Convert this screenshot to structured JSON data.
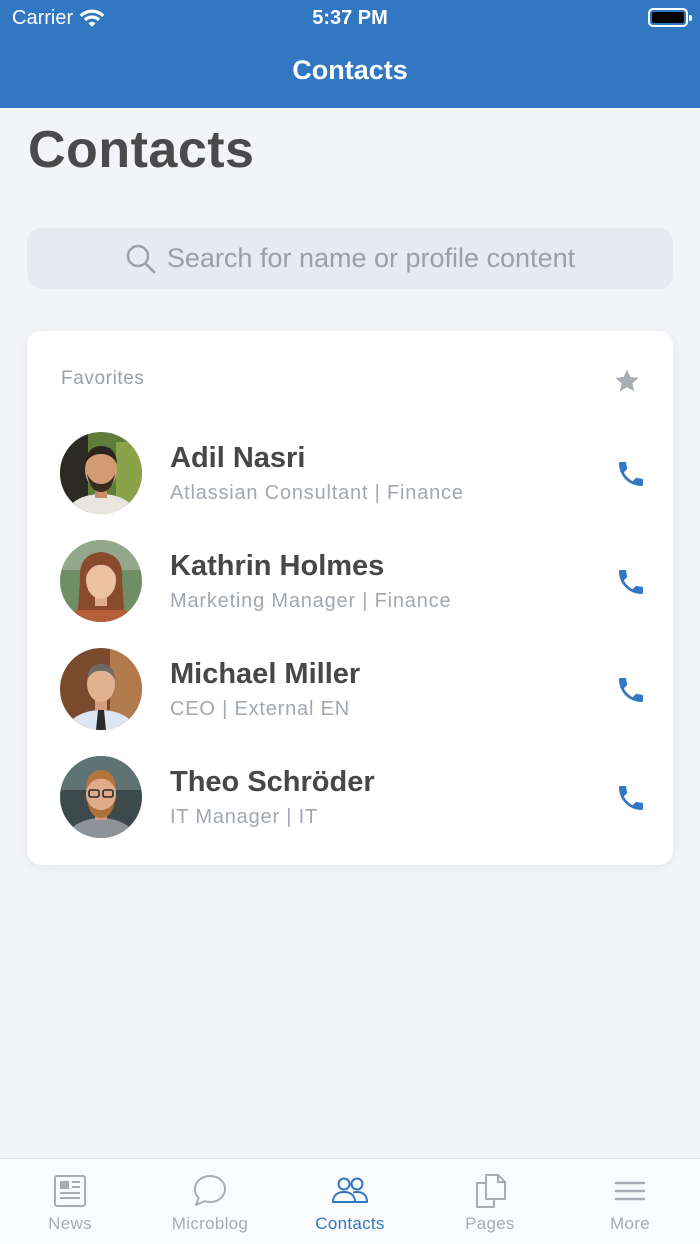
{
  "status_bar": {
    "carrier": "Carrier",
    "time": "5:37 PM"
  },
  "nav": {
    "title": "Contacts"
  },
  "page": {
    "title": "Contacts"
  },
  "search": {
    "placeholder": "Search for name or profile content"
  },
  "favorites": {
    "heading": "Favorites",
    "contacts": [
      {
        "name": "Adil Nasri",
        "role": "Atlassian Consultant | Finance"
      },
      {
        "name": "Kathrin Holmes",
        "role": "Marketing Manager | Finance"
      },
      {
        "name": "Michael Miller",
        "role": "CEO | External EN"
      },
      {
        "name": "Theo Schröder",
        "role": "IT Manager | IT"
      }
    ]
  },
  "tabs": [
    {
      "label": "News",
      "icon": "news-icon"
    },
    {
      "label": "Microblog",
      "icon": "chat-bubble-icon"
    },
    {
      "label": "Contacts",
      "icon": "people-icon",
      "active": true
    },
    {
      "label": "Pages",
      "icon": "pages-icon"
    },
    {
      "label": "More",
      "icon": "menu-icon"
    }
  ],
  "colors": {
    "accent": "#3177c1",
    "background": "#f2f4f8",
    "muted": "#a2a8b0"
  }
}
